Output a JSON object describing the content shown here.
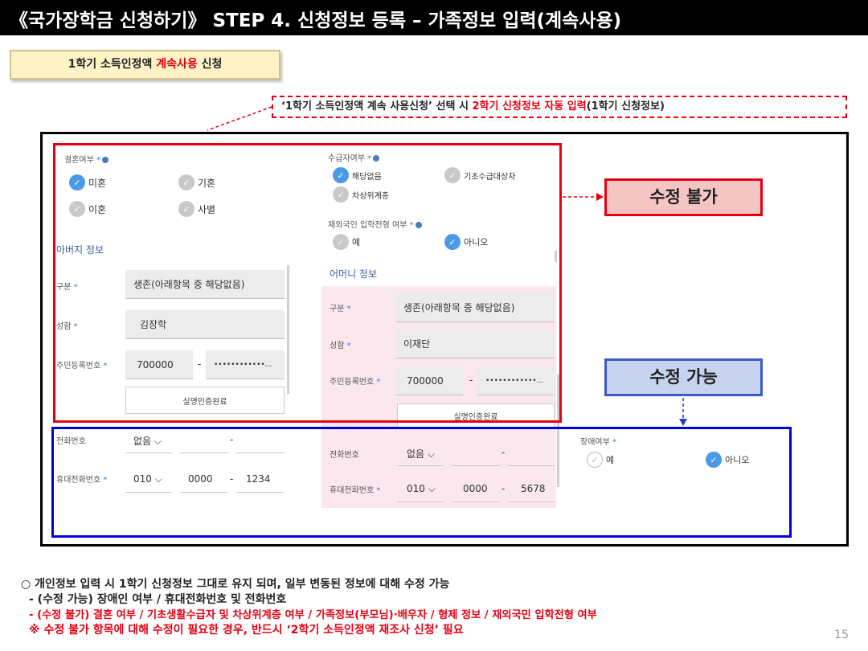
{
  "title": "《국가장학금 신청하기》 STEP 4. 신청정보 등록 – 가족정보 입력(계속사용)",
  "tag": {
    "prefix": "1학기 소득인정액 ",
    "highlight": "계속사용",
    "suffix": " 신청"
  },
  "callout": {
    "part1": "‘1학기 소득인정액 계속 사용신청’ 선택 시 ",
    "highlight": "2학기 신청정보 자동 입력",
    "part2": "(1학기 신청정보)"
  },
  "badges": {
    "no_modify": "수정 불가",
    "can_modify": "수정 가능"
  },
  "form": {
    "marital": {
      "label": "결혼여부",
      "options": [
        "미혼",
        "기혼",
        "이혼",
        "사별"
      ],
      "selected": "미혼"
    },
    "recipient": {
      "label": "수급자여부",
      "options": [
        "해당없음",
        "기초수급대상자",
        "차상위계층"
      ],
      "selected": "해당없음"
    },
    "overseas": {
      "label": "재외국인 입학전형 여부",
      "options": [
        "예",
        "아니오"
      ],
      "selected": "아니오"
    },
    "father": {
      "section": "아버지 정보",
      "type_label": "구분",
      "type_value": "생존(아래항목 중 해당없음)",
      "name_label": "성함",
      "name_value": "김장학",
      "rrn_label": "주민등록번호",
      "rrn_front": "700000",
      "rrn_back": "••••••••••••...",
      "verify_button": "실명인증완료",
      "phone_label": "전화번호",
      "phone_area": "없음",
      "mobile_label": "휴대전화번호",
      "mobile_1": "010",
      "mobile_2": "0000",
      "mobile_3": "1234"
    },
    "mother": {
      "section": "어머니 정보",
      "type_label": "구분",
      "type_value": "생존(아래항목 중 해당없음)",
      "name_label": "성함",
      "name_value": "이재단",
      "rrn_label": "주민등록번호",
      "rrn_front": "700000",
      "rrn_back": "••••••••••••...",
      "verify_button": "실명인증완료",
      "phone_label": "전화번호",
      "phone_area": "없음",
      "mobile_label": "휴대전화번호",
      "mobile_1": "010",
      "mobile_2": "0000",
      "mobile_3": "5678"
    },
    "disability": {
      "label": "장애여부",
      "options": [
        "예",
        "아니오"
      ],
      "selected": "아니오"
    }
  },
  "notes": {
    "line1": "○ 개인정보 입력 시 1학기 신청정보 그대로 유지 되며, 일부 변동된 정보에 대해 수정 가능",
    "line2": "- (수정 가능) 장애인 여부 / 휴대전화번호 및 전화번호",
    "line3": "- (수정 불가) 결혼 여부 / 기초생활수급자 및 차상위계층 여부 / 가족정보(부모님)·배우자 / 형제 정보 / 재외국민 입학전형 여부",
    "line4": "※ 수정 불가 항목에 대해 수정이 필요한 경우, 반드시 ‘2학기 소득인정액 재조사 신청’ 필요"
  },
  "page_number": "15",
  "colors": {
    "accent_red": "#e60012",
    "accent_blue": "#0000e0",
    "radio_on": "#4a9ae8"
  }
}
